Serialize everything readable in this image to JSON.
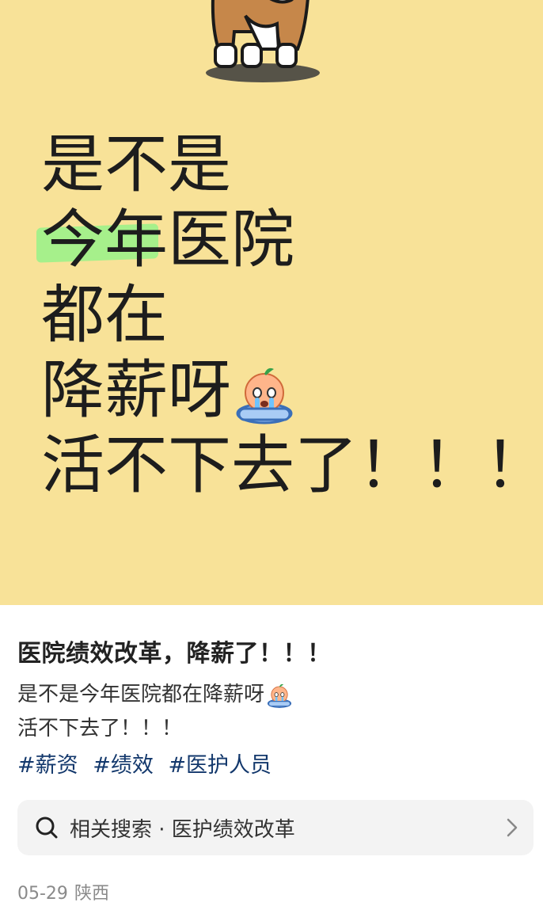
{
  "cover": {
    "lines": [
      "是不是",
      "今年",
      "医院",
      "都在",
      "降薪呀",
      "活不下去了！！！"
    ],
    "highlight_color": "#a6f08b",
    "background_color": "#f8e298",
    "emoji": "crying-emoji"
  },
  "post": {
    "title": "医院绩效改革，降薪了！！！",
    "body_line_1": "是不是今年医院都在降薪呀",
    "body_line_2": "活不下去了！！！",
    "emoji": "crying-emoji",
    "tags": [
      "#薪资",
      "#绩效",
      "#医护人员"
    ],
    "tag_color": "#13386c"
  },
  "related_search": {
    "label": "相关搜索 · 医护绩效改革",
    "icon": "search-icon",
    "arrow_icon": "chevron-right-icon"
  },
  "meta": {
    "date": "05-29",
    "location": "陕西"
  }
}
